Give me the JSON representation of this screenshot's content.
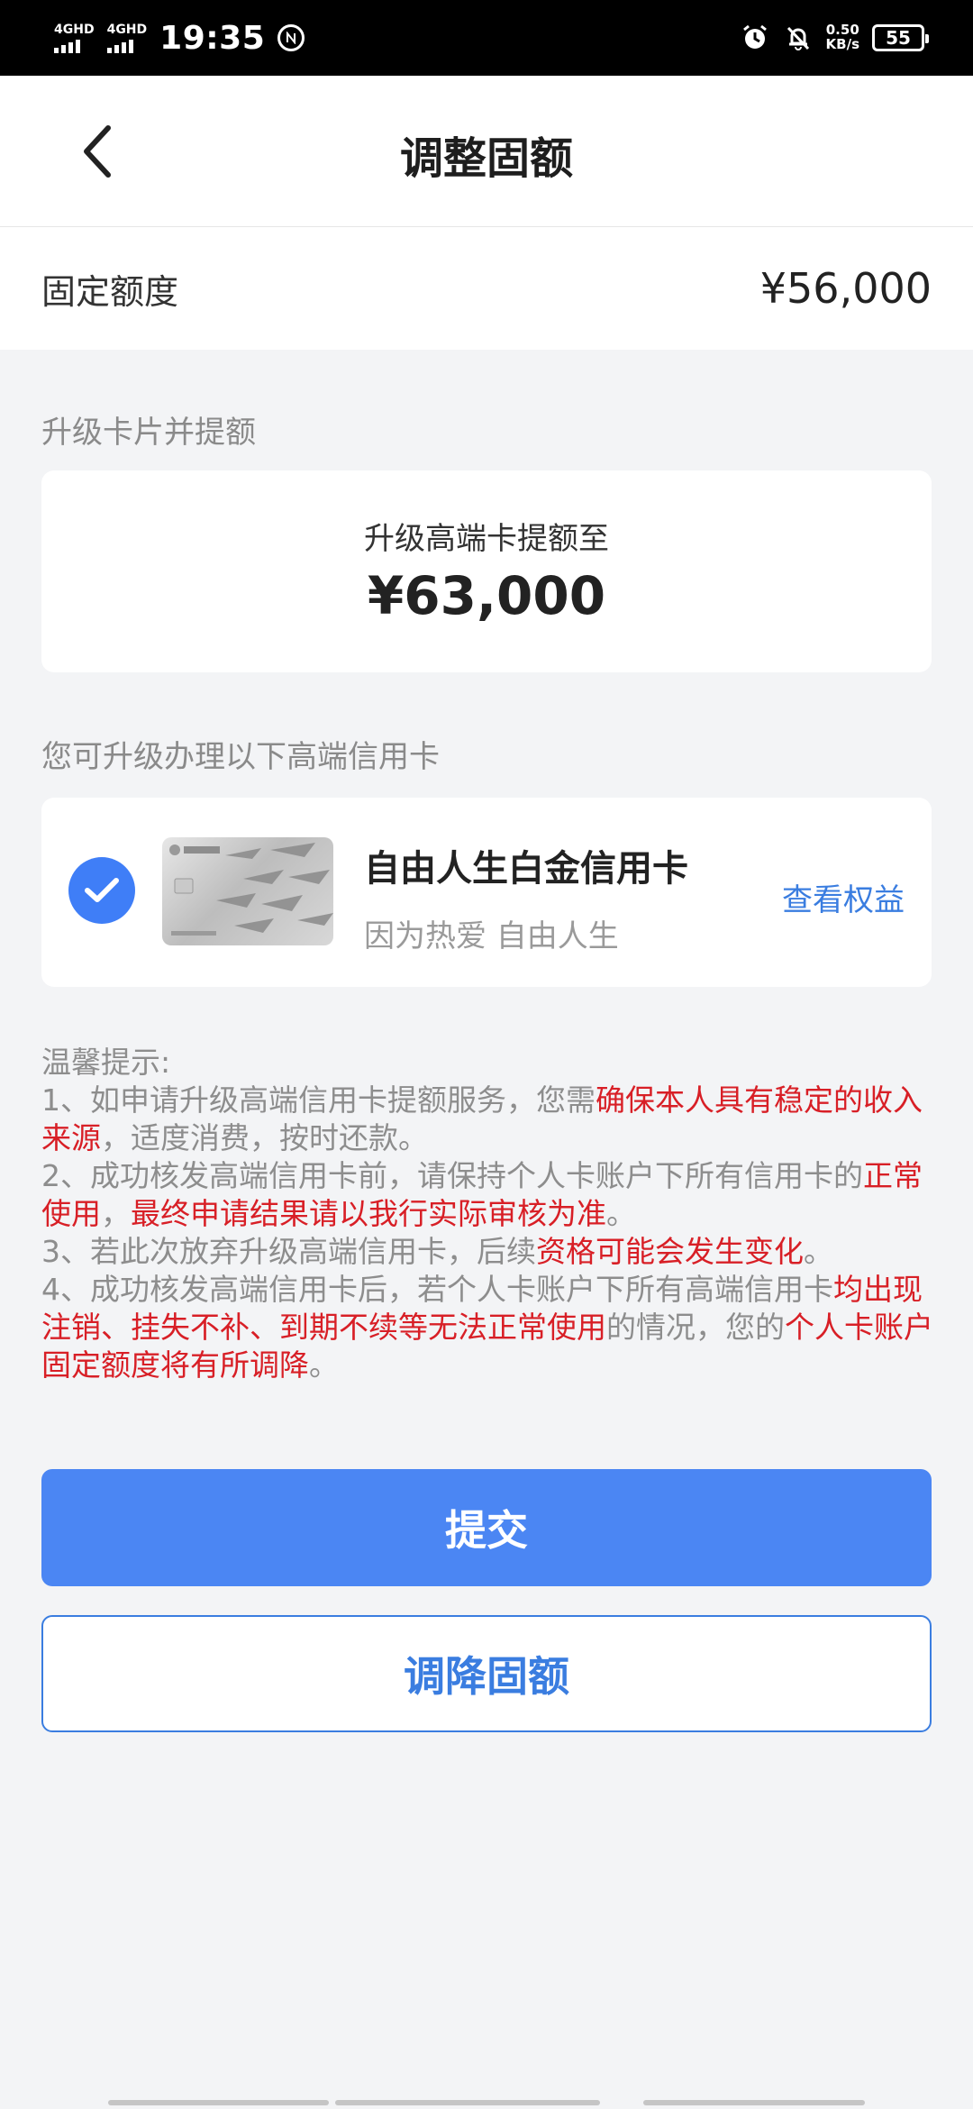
{
  "status_bar": {
    "network1": "4GHD",
    "network2": "4GHD",
    "time": "19:35",
    "speed_value": "0.50",
    "speed_unit": "KB/s",
    "battery": "55"
  },
  "header": {
    "title": "调整固额"
  },
  "fixed_quota": {
    "label": "固定额度",
    "value": "¥56,000"
  },
  "upgrade_section": {
    "label": "升级卡片并提额",
    "card_title": "升级高端卡提额至",
    "amount": "¥63,000"
  },
  "card_section": {
    "label": "您可升级办理以下高端信用卡",
    "card_name": "自由人生白金信用卡",
    "card_slogan": "因为热爱 自由人生",
    "benefits_link": "查看权益",
    "selected": true
  },
  "tips": {
    "heading": "温馨提示:",
    "t1_a": "1、如申请升级高端信用卡提额服务，您需",
    "t1_b": "确保本人具有稳定的收入来源",
    "t1_c": "，适度消费，按时还款。",
    "t2_a": "2、成功核发高端信用卡前，请保持个人卡账户下所有信用卡的",
    "t2_b": "正常使用",
    "t2_c": "，",
    "t2_d": "最终申请结果请以我行实际审核为准",
    "t2_e": "。",
    "t3_a": "3、若此次放弃升级高端信用卡，后续",
    "t3_b": "资格可能会发生变化",
    "t3_c": "。",
    "t4_a": "4、成功核发高端信用卡后，若个人卡账户下所有高端信用卡",
    "t4_b": "均出现注销、挂失不补、到期不续等无法正常使用",
    "t4_c": "的情况，您的",
    "t4_d": "个人卡账户固定额度将有所调降",
    "t4_e": "。"
  },
  "buttons": {
    "submit": "提交",
    "reduce": "调降固额"
  },
  "colors": {
    "primary_blue": "#4b86f3",
    "link_blue": "#3a7de0",
    "warning_red": "#d81f26",
    "page_bg": "#f3f4f6"
  },
  "icons": [
    "back-arrow-icon",
    "check-icon",
    "alarm-icon",
    "bell-off-icon",
    "battery-icon",
    "signal-icon",
    "nfc-icon"
  ]
}
